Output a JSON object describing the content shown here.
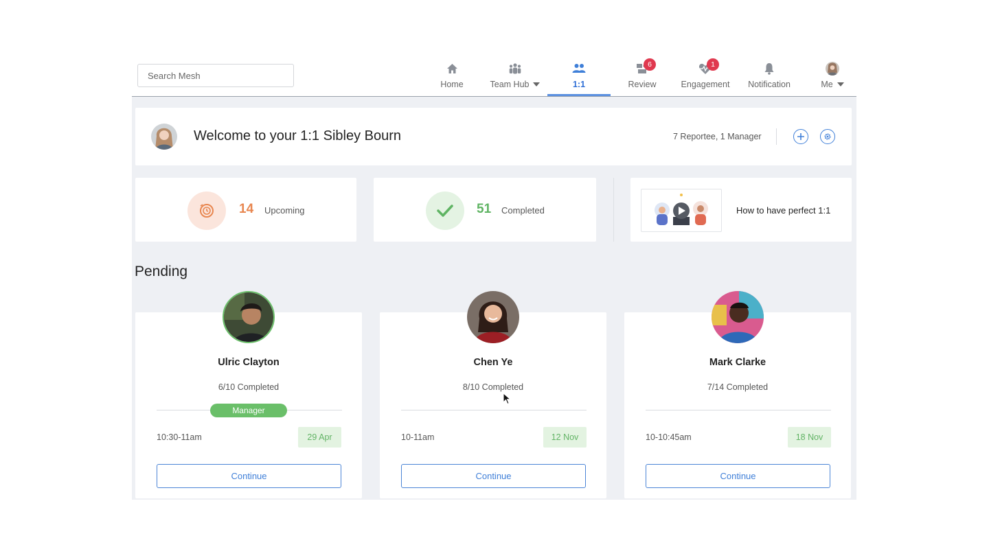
{
  "search": {
    "placeholder": "Search Mesh"
  },
  "nav": {
    "items": [
      {
        "label": "Home",
        "icon": "home-icon"
      },
      {
        "label": "Team Hub",
        "icon": "team-icon",
        "has_dropdown": true
      },
      {
        "label": "1:1",
        "icon": "one-on-one-icon",
        "active": true
      },
      {
        "label": "Review",
        "icon": "review-icon",
        "badge": "6"
      },
      {
        "label": "Engagement",
        "icon": "engagement-icon",
        "badge": "1"
      },
      {
        "label": "Notification",
        "icon": "bell-icon"
      },
      {
        "label": "Me",
        "icon": "avatar",
        "has_dropdown": true
      }
    ]
  },
  "welcome": {
    "title": "Welcome to your 1:1 Sibley Bourn",
    "summary": "7 Reportee, 1 Manager",
    "add_icon": "plus-icon",
    "settings_icon": "gear-icon"
  },
  "stats": {
    "upcoming": {
      "value": "14",
      "label": "Upcoming",
      "color": "#e8864f"
    },
    "completed": {
      "value": "51",
      "label": "Completed",
      "color": "#5fb463"
    },
    "guide": {
      "label": "How to have perfect 1:1"
    }
  },
  "pending": {
    "title": "Pending",
    "people": [
      {
        "name": "Ulric Clayton",
        "progress": "6/10 Completed",
        "role": "Manager",
        "time": "10:30-11am",
        "date": "29 Apr",
        "action": "Continue"
      },
      {
        "name": "Chen Ye",
        "progress": "8/10 Completed",
        "role": "",
        "time": "10-11am",
        "date": "12 Nov",
        "action": "Continue"
      },
      {
        "name": "Mark Clarke",
        "progress": "7/14 Completed",
        "role": "",
        "time": "10-10:45am",
        "date": "18 Nov",
        "action": "Continue"
      }
    ]
  },
  "colors": {
    "accent": "#3f7fd8",
    "badge": "#e0394f",
    "success": "#6abf69",
    "background": "#eef0f4"
  }
}
